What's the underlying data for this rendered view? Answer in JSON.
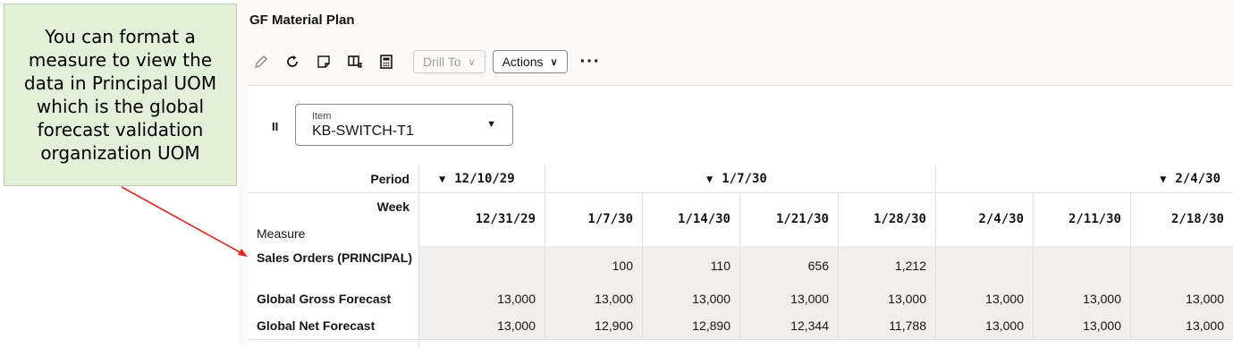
{
  "callout": {
    "lines": [
      "You can format a",
      "measure to view the",
      "data in Principal UOM",
      "which is the global",
      "forecast validation",
      "organization UOM"
    ]
  },
  "app": {
    "title": "GF Material Plan",
    "toolbar": {
      "drill_to_label": "Drill To",
      "actions_label": "Actions",
      "more_label": "···",
      "icons": [
        "edit-icon",
        "refresh-icon",
        "note-icon",
        "layout-icon",
        "calculator-icon"
      ]
    },
    "selector": {
      "label": "Item",
      "value": "KB-SWITCH-T1",
      "pause_glyph": "II"
    },
    "grid": {
      "period_label": "Period",
      "week_label": "Week",
      "measure_label": "Measure",
      "periods": [
        "12/10/29",
        "1/7/30",
        "2/4/30"
      ],
      "weeks": [
        "12/31/29",
        "1/7/30",
        "1/14/30",
        "1/21/30",
        "1/28/30",
        "2/4/30",
        "2/11/30",
        "2/18/30"
      ],
      "rows": [
        {
          "measure": "Sales Orders (PRINCIPAL)",
          "values": [
            "",
            "100",
            "110",
            "656",
            "1,212",
            "",
            "",
            ""
          ]
        },
        {
          "measure": "Global Gross Forecast",
          "values": [
            "13,000",
            "13,000",
            "13,000",
            "13,000",
            "13,000",
            "13,000",
            "13,000",
            "13,000"
          ]
        },
        {
          "measure": "Global Net Forecast",
          "values": [
            "13,000",
            "12,900",
            "12,890",
            "12,344",
            "11,788",
            "13,000",
            "13,000",
            "13,000"
          ]
        }
      ]
    }
  },
  "colors": {
    "callout_bg": "#e2efd9",
    "arrow": "#e8231f",
    "row_shade": "#f1efed"
  }
}
